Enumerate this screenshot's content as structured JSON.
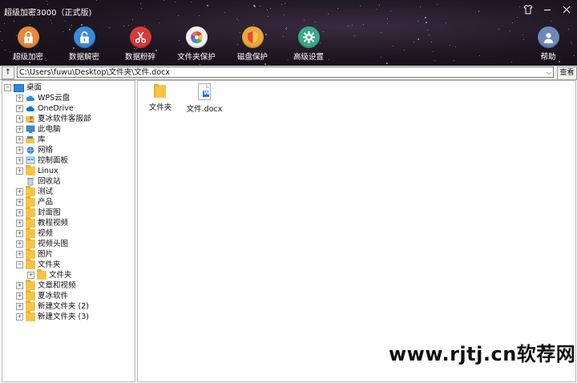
{
  "window": {
    "title": "超级加密3000（正式版)",
    "controls": [
      "shirt-icon",
      "minimize-icon",
      "close-icon"
    ]
  },
  "toolbar": {
    "items": [
      {
        "label": "超级加密",
        "icon": "lock-icon",
        "color": "#e7873a"
      },
      {
        "label": "数据解密",
        "icon": "unlock-icon",
        "color": "#3a8ad8"
      },
      {
        "label": "数据粉碎",
        "icon": "scissors-icon",
        "color": "#d73a3a"
      },
      {
        "label": "文件夹保护",
        "icon": "pinwheel-icon",
        "color": "#f2f2f2"
      },
      {
        "label": "磁盘保护",
        "icon": "shield-icon",
        "color": "#e8a83a"
      },
      {
        "label": "高级设置",
        "icon": "gear-icon",
        "color": "#3aa88a"
      }
    ],
    "help": {
      "label": "帮助",
      "icon": "user-icon",
      "color": "#6a88b8"
    }
  },
  "address": {
    "up": "↑",
    "path": "C:\\Users\\fuwu\\Desktop\\文件夹\\文件.docx",
    "dropdown_arrow": "⌵",
    "view_label": "查看"
  },
  "tree": {
    "root": "桌面",
    "items": [
      {
        "label": "WPS云盘",
        "icon": "cloud-icon",
        "color": "#2a8ae0"
      },
      {
        "label": "OneDrive",
        "icon": "onedrive-icon",
        "color": "#1a70d0"
      },
      {
        "label": "夏冰软件客服部",
        "icon": "user-folder-icon",
        "color": "#e0a030"
      },
      {
        "label": "此电脑",
        "icon": "computer-icon",
        "color": "#3a8ad8"
      },
      {
        "label": "库",
        "icon": "library-icon",
        "color": "#e8b040"
      },
      {
        "label": "网络",
        "icon": "network-icon",
        "color": "#3a8ad8"
      },
      {
        "label": "控制面板",
        "icon": "control-panel-icon",
        "color": "#3a8ad8"
      },
      {
        "label": "Linux",
        "icon": "folder-icon",
        "color": "#f6c444"
      },
      {
        "label": "回收站",
        "icon": "recycle-bin-icon",
        "color": "#8a9aaa"
      },
      {
        "label": "测试",
        "icon": "folder-icon",
        "color": "#f6c444"
      },
      {
        "label": "产品",
        "icon": "folder-icon",
        "color": "#f6c444"
      },
      {
        "label": "封面图",
        "icon": "folder-icon",
        "color": "#f6c444"
      },
      {
        "label": "教程视频",
        "icon": "folder-icon",
        "color": "#f6c444"
      },
      {
        "label": "视频",
        "icon": "folder-icon",
        "color": "#f6c444"
      },
      {
        "label": "视频头图",
        "icon": "folder-icon",
        "color": "#f6c444"
      },
      {
        "label": "图片",
        "icon": "folder-icon",
        "color": "#f6c444"
      },
      {
        "label": "文件夹",
        "icon": "folder-icon",
        "color": "#f6c444"
      },
      {
        "label": "文件夹",
        "icon": "folder-icon",
        "color": "#f6c444"
      },
      {
        "label": "文章和视频",
        "icon": "folder-icon",
        "color": "#f6c444"
      },
      {
        "label": "夏冰软件",
        "icon": "folder-icon",
        "color": "#f6c444"
      },
      {
        "label": "新建文件夹 (2)",
        "icon": "folder-icon",
        "color": "#f6c444"
      },
      {
        "label": "新建文件夹 (3)",
        "icon": "folder-icon",
        "color": "#f6c444"
      }
    ]
  },
  "files": [
    {
      "label": "文件夹",
      "icon": "folder-icon"
    },
    {
      "label": "文件.docx",
      "icon": "word-doc-icon",
      "badge": "W"
    }
  ],
  "watermark": "www.rjtj.cn软荐网"
}
